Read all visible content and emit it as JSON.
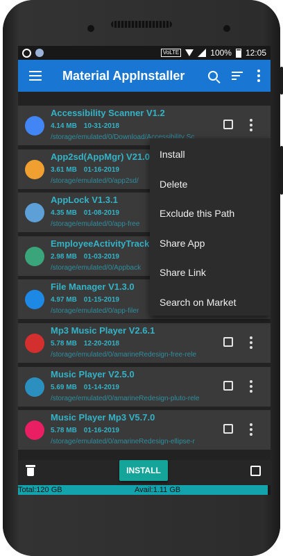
{
  "status_bar": {
    "network_label": "VoLTE",
    "battery": "100%",
    "time": "12:05",
    "icons": [
      "whatsapp-icon",
      "notification-dot-icon",
      "volte-icon",
      "wifi-icon",
      "signal-icon",
      "battery-icon"
    ]
  },
  "toolbar": {
    "title": "Material AppInstaller",
    "icons": [
      "menu-icon",
      "search-icon",
      "sort-icon",
      "more-vert-icon"
    ]
  },
  "apps": [
    {
      "name": "Accessibility Scanner V1.2",
      "size": "4.14 MB",
      "date": "10-31-2018",
      "path": "/storage/emulated/0/Download/Accessibility Sc",
      "icon": "accessibility-scanner-icon",
      "icon_color": "#4285f4"
    },
    {
      "name": "App2sd(AppMgr) V21.0",
      "size": "3.61 MB",
      "date": "01-16-2019",
      "path": "/storage/emulated/0/app2sd/",
      "icon": "app2sd-icon",
      "icon_color": "#f0a030"
    },
    {
      "name": "AppLock V1.3.1",
      "size": "4.35 MB",
      "date": "01-08-2019",
      "path": "/storage/emulated/0/app-free",
      "icon": "applock-icon",
      "icon_color": "#5da0d8"
    },
    {
      "name": "EmployeeActivityTracker",
      "size": "2.98 MB",
      "date": "01-03-2019",
      "path": "/storage/emulated/0/Appback",
      "icon": "android-icon",
      "icon_color": "#3aa57a"
    },
    {
      "name": "File Manager V1.3.0",
      "size": "4.97 MB",
      "date": "01-15-2019",
      "path": "/storage/emulated/0/app-filer",
      "icon": "folder-search-icon",
      "icon_color": "#1e88e5"
    },
    {
      "name": "Mp3 Music Player V2.6.1",
      "size": "5.78 MB",
      "date": "12-20-2018",
      "path": "/storage/emulated/0/amarineRedesign-free-rele",
      "icon": "music-note-icon",
      "icon_color": "#d32f2f"
    },
    {
      "name": "Music Player V2.5.0",
      "size": "5.69 MB",
      "date": "01-14-2019",
      "path": "/storage/emulated/0/amarineRedesign-pluto-rele",
      "icon": "play-icon",
      "icon_color": "#2b8fbf"
    },
    {
      "name": "Music Player Mp3 V5.7.0",
      "size": "5.78 MB",
      "date": "01-16-2019",
      "path": "/storage/emulated/0/amarineRedesign-ellipse-r",
      "icon": "music-note-icon",
      "icon_color": "#e91e63"
    }
  ],
  "context_menu": {
    "items": [
      "Install",
      "Delete",
      "Exclude this Path",
      "Share App",
      "Share Link",
      "Search on Market"
    ]
  },
  "bottom_bar": {
    "install_label": "INSTALL",
    "icons": [
      "trash-icon",
      "select-all-checkbox"
    ]
  },
  "storage": {
    "total": "Total:120 GB",
    "avail": "Avail:1.11 GB",
    "used_fraction": 0.99,
    "fill_color": "#12a3ad"
  }
}
